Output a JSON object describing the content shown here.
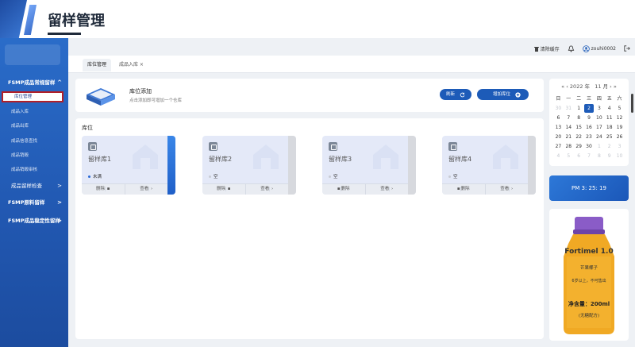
{
  "header": {
    "title": "留样管理"
  },
  "toolbar": {
    "clear_cache": "清除缓存",
    "username": "zouhi0002"
  },
  "sidebar": {
    "groups": [
      {
        "label": "FSMP成品常规留样",
        "chev": "^"
      },
      {
        "label": "成品留样检查",
        "chev": ">"
      },
      {
        "label": "FSMP原料留样",
        "chev": ">"
      },
      {
        "label": "FSMP成品稳定性留样",
        "chev": ">"
      }
    ],
    "items": [
      {
        "label": "库位管理"
      },
      {
        "label": "成品入库"
      },
      {
        "label": "成品出库"
      },
      {
        "label": "成品信息查找"
      },
      {
        "label": "成品销毁"
      },
      {
        "label": "成品销毁审核"
      }
    ]
  },
  "tabs": [
    {
      "label": "库位管理"
    },
    {
      "label": "成品入库 ×"
    }
  ],
  "add_panel": {
    "title": "库位添加",
    "desc": "点击添加即可增加一个仓库",
    "refresh_label": "刷新",
    "add_label": "增加库位"
  },
  "locations": {
    "label": "库位",
    "cards": [
      {
        "name": "留样库1",
        "status": "未满",
        "delete": "删除",
        "view": "查看"
      },
      {
        "name": "留样库2",
        "status": "空",
        "delete": "删除",
        "view": "查看"
      },
      {
        "name": "留样库3",
        "status": "空",
        "delete": "删除",
        "view": "查看"
      },
      {
        "name": "留样库4",
        "status": "空",
        "delete": "删除",
        "view": "查看"
      }
    ]
  },
  "calendar": {
    "year": "2022 年",
    "month": "11 月",
    "weekdays": [
      "日",
      "一",
      "二",
      "三",
      "四",
      "五",
      "六"
    ],
    "rows": [
      [
        "30",
        "31",
        "1",
        "2",
        "3",
        "4",
        "5"
      ],
      [
        "6",
        "7",
        "8",
        "9",
        "10",
        "11",
        "12"
      ],
      [
        "13",
        "14",
        "15",
        "16",
        "17",
        "18",
        "19"
      ],
      [
        "20",
        "21",
        "22",
        "23",
        "24",
        "25",
        "26"
      ],
      [
        "27",
        "28",
        "29",
        "30",
        "1",
        "2",
        "3"
      ],
      [
        "4",
        "5",
        "6",
        "7",
        "8",
        "9",
        "10"
      ]
    ],
    "selected": "2"
  },
  "clock": {
    "time": "PM 3: 25: 19"
  },
  "product": {
    "brand": "Fortimel 1.0",
    "flavor": "芒果椰子",
    "line2": "6岁以上，不可售出",
    "volume": "净含量：200ml",
    "note": "(无糖配方)"
  },
  "colors": {
    "primary": "#1d5bb8",
    "sidebar": "#2157b0",
    "active_border": "#b11f28"
  }
}
